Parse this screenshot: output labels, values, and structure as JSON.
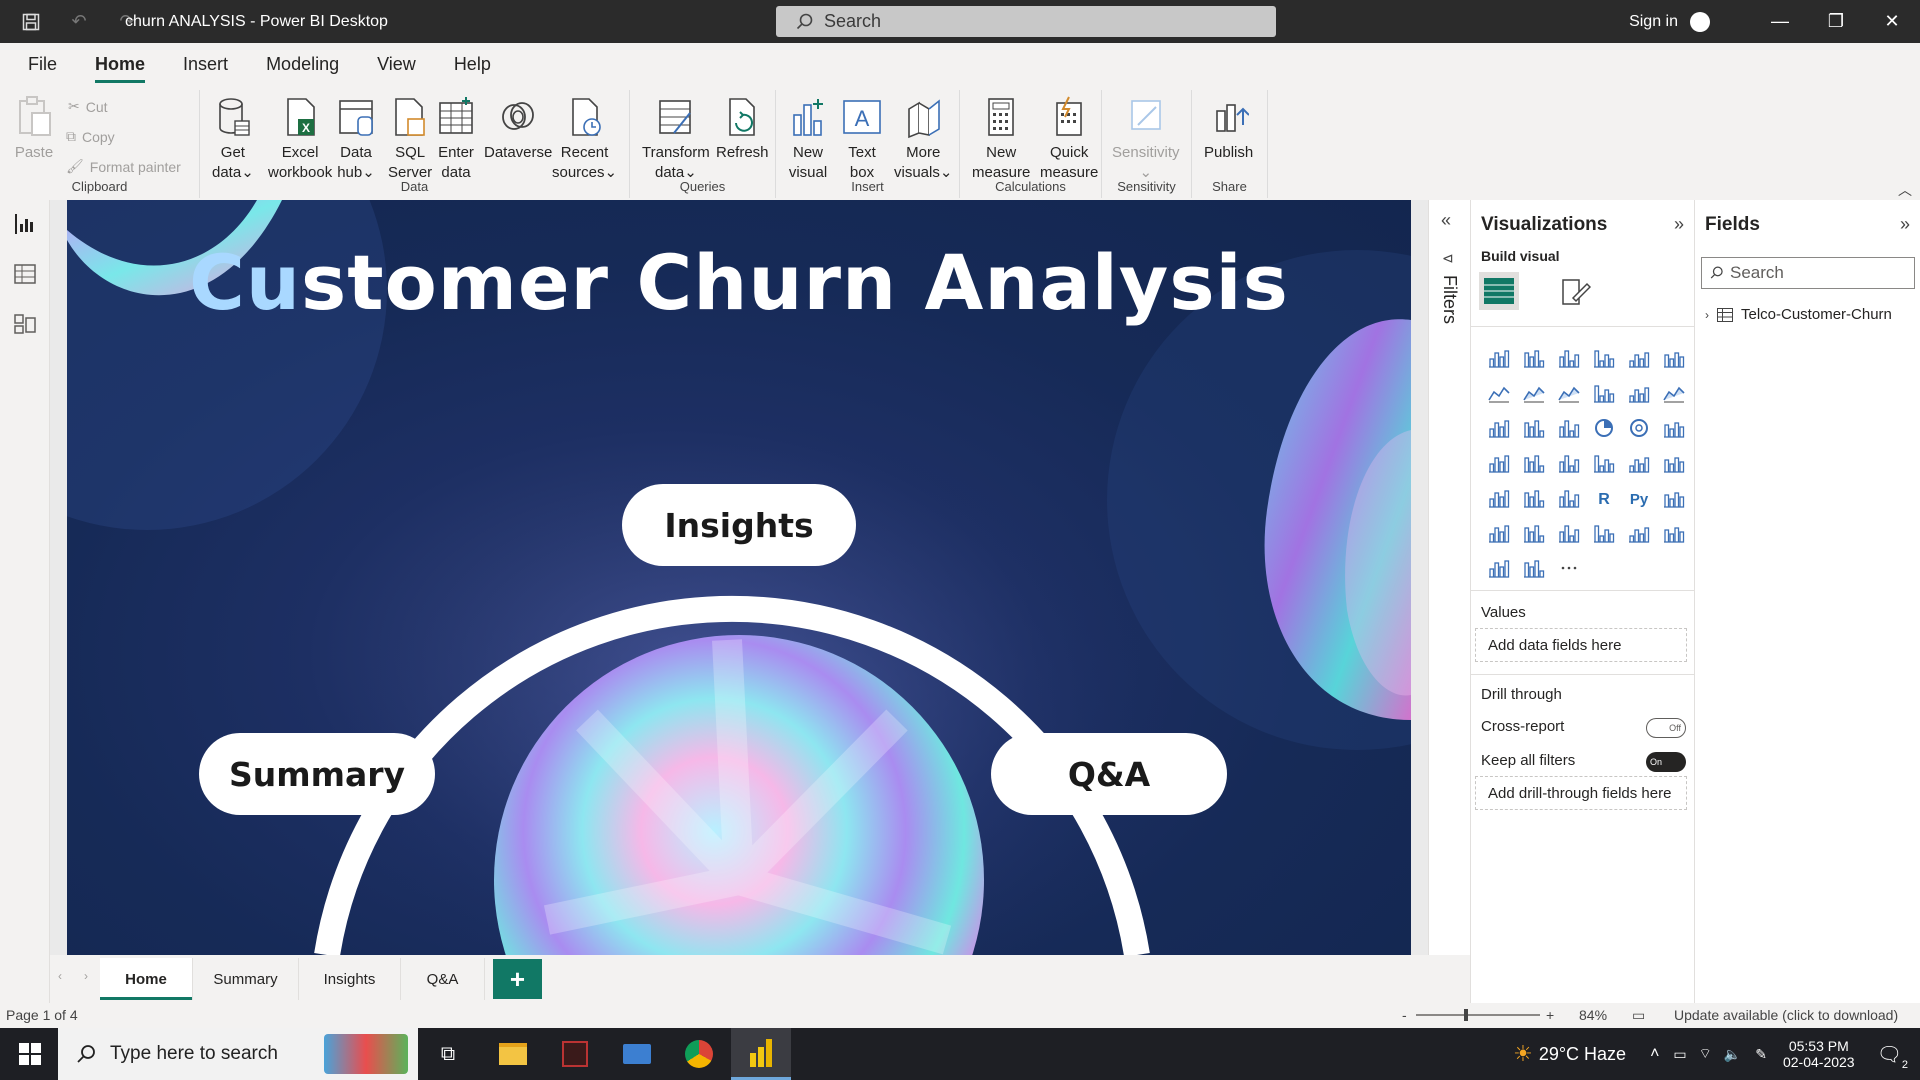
{
  "window": {
    "title": "churn ANALYSIS - Power BI Desktop",
    "search_placeholder": "Search",
    "signin": "Sign in"
  },
  "menu": {
    "tabs": [
      "File",
      "Home",
      "Insert",
      "Modeling",
      "View",
      "Help"
    ],
    "active": "Home"
  },
  "ribbon": {
    "clipboard": {
      "label": "Clipboard",
      "paste": "Paste",
      "cut": "Cut",
      "copy": "Copy",
      "format_painter": "Format painter"
    },
    "data": {
      "label": "Data",
      "get_data": [
        "Get",
        "data"
      ],
      "excel": [
        "Excel",
        "workbook"
      ],
      "data_hub": [
        "Data",
        "hub"
      ],
      "sql": [
        "SQL",
        "Server"
      ],
      "enter_data": [
        "Enter",
        "data"
      ],
      "dataverse": "Dataverse",
      "recent": [
        "Recent",
        "sources"
      ]
    },
    "queries": {
      "label": "Queries",
      "transform": [
        "Transform",
        "data"
      ],
      "refresh": "Refresh"
    },
    "insert": {
      "label": "Insert",
      "new_visual": [
        "New",
        "visual"
      ],
      "text_box": [
        "Text",
        "box"
      ],
      "more_visuals": [
        "More",
        "visuals"
      ]
    },
    "calculations": {
      "label": "Calculations",
      "new_measure": [
        "New",
        "measure"
      ],
      "quick_measure": [
        "Quick",
        "measure"
      ]
    },
    "sensitivity": {
      "label": "Sensitivity",
      "btn": "Sensitivity"
    },
    "share": {
      "label": "Share",
      "publish": "Publish"
    }
  },
  "report": {
    "title_part1": "Cu",
    "title_part2": "stomer Churn Analysis",
    "pills": {
      "insights": "Insights",
      "summary": "Summary",
      "qa": "Q&A"
    }
  },
  "filters_pane": {
    "label": "Filters"
  },
  "visualizations": {
    "title": "Visualizations",
    "build_visual": "Build visual",
    "values_label": "Values",
    "values_placeholder": "Add data fields here",
    "drill_through": "Drill through",
    "cross_report": "Cross-report",
    "cross_report_state": "Off",
    "keep_filters": "Keep all filters",
    "keep_filters_state": "On",
    "drill_placeholder": "Add drill-through fields here"
  },
  "fields": {
    "title": "Fields",
    "search_placeholder": "Search",
    "tables": [
      "Telco-Customer-Churn"
    ]
  },
  "page_tabs": {
    "tabs": [
      "Home",
      "Summary",
      "Insights",
      "Q&A"
    ],
    "active": "Home",
    "add": "+"
  },
  "status": {
    "page": "Page 1 of 4",
    "zoom_minus": "-",
    "zoom_plus": "+",
    "zoom": "84%",
    "update": "Update available (click to download)"
  },
  "taskbar": {
    "search_placeholder": "Type here to search",
    "weather": "29°C  Haze",
    "time": "05:53 PM",
    "date": "02-04-2023",
    "notifications": "2"
  },
  "colors": {
    "accent": "#117865",
    "canvas_dark": "#162a57",
    "title_gradient_start": "#a9d8ff"
  }
}
